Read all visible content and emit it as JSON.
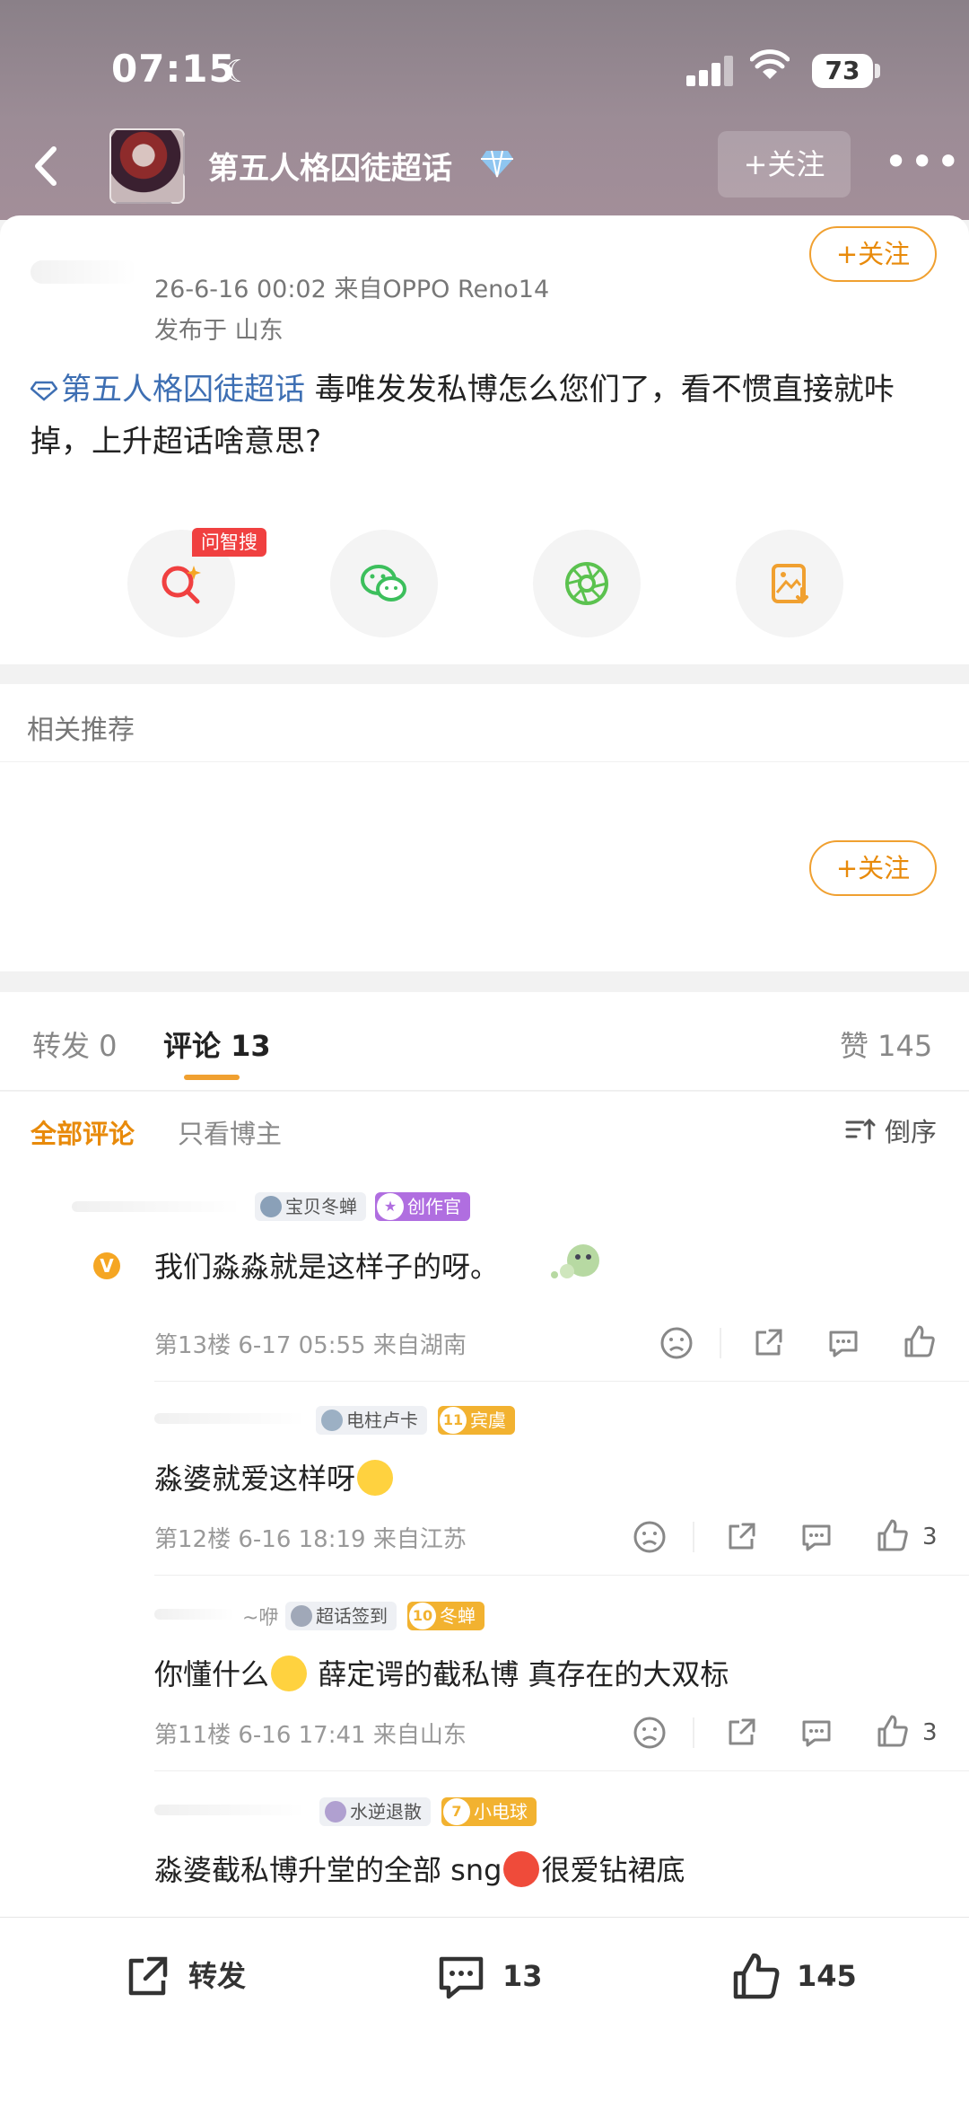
{
  "status": {
    "time": "07:15",
    "battery": "73"
  },
  "header": {
    "title": "第五人格囚徒超话",
    "follow_label": "+关注",
    "more_label": "•••"
  },
  "post": {
    "time_source": "26-6-16 00:02  来自OPPO Reno14",
    "location": "发布于 山东",
    "follow_label": "+关注",
    "topic": "第五人格囚徒超话",
    "text": " 毒唯发发私博怎么您们了，看不惯直接就咔掉，上升超话啥意思?"
  },
  "share": {
    "ai_badge": "问智搜"
  },
  "related": {
    "title": "相关推荐",
    "follow_label": "+关注"
  },
  "tabs": {
    "repost": "转发 0",
    "comment": "评论 13",
    "likes": "赞 145"
  },
  "filters": {
    "all": "全部评论",
    "owner": "只看博主",
    "sort": "倒序"
  },
  "comments": [
    {
      "medal": "宝贝冬蝉",
      "level": "创作官",
      "text": "我们淼淼就是这样子的呀。",
      "meta": "第13楼 6-17 05:55 来自湖南",
      "likes": ""
    },
    {
      "medal": "电柱卢卡",
      "level_num": "11",
      "level": "宾虞",
      "text": "淼婆就爱这样呀",
      "meta": "第12楼 6-16 18:19 来自江苏",
      "likes": "3"
    },
    {
      "name_tail": "~咿",
      "medal": "超话签到",
      "level_num": "10",
      "level": "冬蝉",
      "text_a": "你懂什么",
      "text_b": "  薛定谔的截私博  真存在的大双标",
      "meta": "第11楼 6-16 17:41 来自山东",
      "likes": "3"
    },
    {
      "medal": "水逆退散",
      "level_num": "7",
      "level": "小电球",
      "text_a": "淼婆截私博升堂的全部 sng",
      "text_b": "很爱钻裙底"
    }
  ],
  "bottom": {
    "repost": "转发",
    "comment": "13",
    "like": "145"
  },
  "colors": {
    "accent": "#f0a030",
    "link": "#3e6fb3",
    "hot": "#f04040"
  }
}
